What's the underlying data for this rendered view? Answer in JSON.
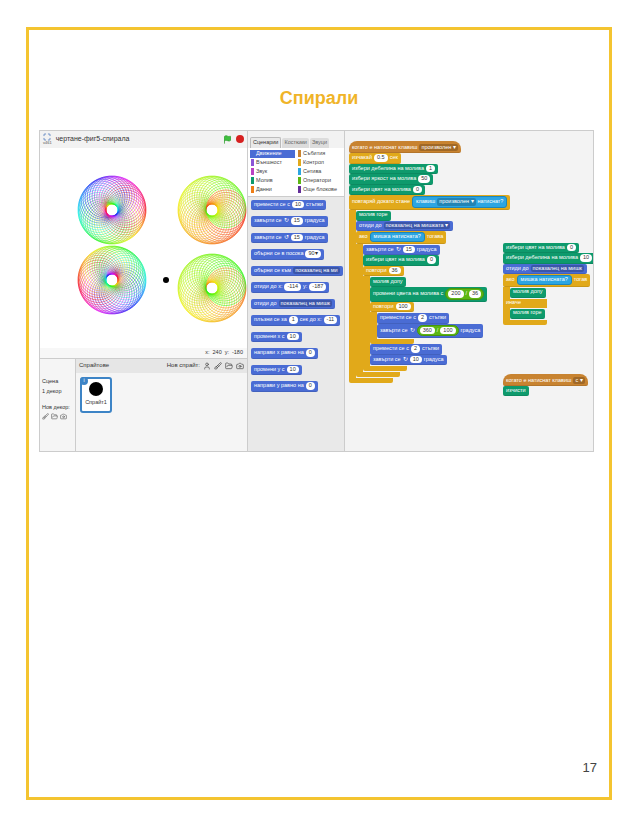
{
  "page": {
    "title": "Спирали",
    "number": "17"
  },
  "stage": {
    "title": "чертане-фиг5-спирала",
    "version": "v461",
    "x_label": "x:",
    "x": "240",
    "y_label": "y:",
    "y": "-180"
  },
  "sprites": {
    "header": "Спрайтове",
    "new_sprite": "Нов спрайт:",
    "stage_label": "Сцена",
    "backdrops": "1 декор",
    "new_backdrop": "Нов декор:",
    "items": [
      {
        "name": "Спрайт1",
        "selected": true,
        "info": "i"
      }
    ]
  },
  "tabs": [
    {
      "label": "Сценарии",
      "selected": true
    },
    {
      "label": "Костюми",
      "selected": false
    },
    {
      "label": "Звуци",
      "selected": false
    }
  ],
  "categories": [
    {
      "label": "Движение",
      "color": "#4a6cd4",
      "selected": true
    },
    {
      "label": "Събития",
      "color": "#c88330",
      "selected": false
    },
    {
      "label": "Външност",
      "color": "#8a55d7",
      "selected": false
    },
    {
      "label": "Контрол",
      "color": "#e1a91a",
      "selected": false
    },
    {
      "label": "Звук",
      "color": "#bb42c3",
      "selected": false
    },
    {
      "label": "Сетива",
      "color": "#2ca5e2",
      "selected": false
    },
    {
      "label": "Молив",
      "color": "#0e9a6c",
      "selected": false
    },
    {
      "label": "Оператори",
      "color": "#5cb712",
      "selected": false
    },
    {
      "label": "Данни",
      "color": "#ee7d16",
      "selected": false
    },
    {
      "label": "Още блокове",
      "color": "#632d99",
      "selected": false
    }
  ],
  "palette": [
    {
      "category": "motion",
      "shape": "stack",
      "parts": [
        {
          "kind": "label",
          "text": "премести се с"
        },
        {
          "kind": "num",
          "text": "10"
        },
        {
          "kind": "label",
          "text": "стъпки"
        }
      ]
    },
    {
      "category": "motion",
      "shape": "stack",
      "parts": [
        {
          "kind": "label",
          "text": "завърти се"
        },
        {
          "kind": "label",
          "text": "↻"
        },
        {
          "kind": "num",
          "text": "15"
        },
        {
          "kind": "label",
          "text": "градуса"
        }
      ]
    },
    {
      "category": "motion",
      "shape": "stack",
      "parts": [
        {
          "kind": "label",
          "text": "завърти се"
        },
        {
          "kind": "label",
          "text": "↺"
        },
        {
          "kind": "num",
          "text": "15"
        },
        {
          "kind": "label",
          "text": "градуса"
        }
      ]
    },
    {
      "category": "motion",
      "shape": "stack",
      "parts": [
        {
          "kind": "label",
          "text": "обърни се в посока"
        },
        {
          "kind": "num",
          "text": "90▾"
        }
      ]
    },
    {
      "category": "motion",
      "shape": "stack",
      "parts": [
        {
          "kind": "label",
          "text": "обърни се към"
        },
        {
          "kind": "drop",
          "text": "показалец на ми"
        }
      ]
    },
    {
      "category": "motion",
      "shape": "stack",
      "parts": [
        {
          "kind": "label",
          "text": "отиди до x:"
        },
        {
          "kind": "num",
          "text": "-114"
        },
        {
          "kind": "label",
          "text": "y:"
        },
        {
          "kind": "num",
          "text": "-187"
        }
      ]
    },
    {
      "category": "motion",
      "shape": "stack",
      "parts": [
        {
          "kind": "label",
          "text": "отиди до"
        },
        {
          "kind": "drop",
          "text": "показалец на мишк"
        }
      ]
    },
    {
      "category": "motion",
      "shape": "stack",
      "parts": [
        {
          "kind": "label",
          "text": "плъзни се за"
        },
        {
          "kind": "num",
          "text": "1"
        },
        {
          "kind": "label",
          "text": "сек до x:"
        },
        {
          "kind": "num",
          "text": "-11"
        }
      ]
    },
    {
      "category": "motion",
      "shape": "stack",
      "parts": [
        {
          "kind": "label",
          "text": "промени x с"
        },
        {
          "kind": "num",
          "text": "10"
        }
      ]
    },
    {
      "category": "motion",
      "shape": "stack",
      "parts": [
        {
          "kind": "label",
          "text": "направи x равно на"
        },
        {
          "kind": "num",
          "text": "0"
        }
      ]
    },
    {
      "category": "motion",
      "shape": "stack",
      "parts": [
        {
          "kind": "label",
          "text": "промени y с"
        },
        {
          "kind": "num",
          "text": "10"
        }
      ]
    },
    {
      "category": "motion",
      "shape": "stack",
      "parts": [
        {
          "kind": "label",
          "text": "направи y равно на"
        },
        {
          "kind": "num",
          "text": "0"
        }
      ]
    }
  ],
  "scripts": [
    {
      "blocks": [
        {
          "category": "events",
          "shape": "hat",
          "parts": [
            {
              "kind": "label",
              "text": "когато е натиснат клавиш"
            },
            {
              "kind": "drop",
              "text": "произволен ▾"
            }
          ]
        },
        {
          "category": "control",
          "shape": "stack",
          "parts": [
            {
              "kind": "label",
              "text": "изчакай"
            },
            {
              "kind": "num",
              "text": "0.5"
            },
            {
              "kind": "label",
              "text": "сек"
            }
          ]
        },
        {
          "category": "pen",
          "shape": "stack",
          "parts": [
            {
              "kind": "label",
              "text": "избери дебелина на молива"
            },
            {
              "kind": "num",
              "text": "1"
            }
          ]
        },
        {
          "category": "pen",
          "shape": "stack",
          "parts": [
            {
              "kind": "label",
              "text": "избери яркост на молива"
            },
            {
              "kind": "num",
              "text": "50"
            }
          ]
        },
        {
          "category": "pen",
          "shape": "stack",
          "parts": [
            {
              "kind": "label",
              "text": "избери цвят на молива"
            },
            {
              "kind": "num",
              "text": "0"
            }
          ]
        },
        {
          "category": "control",
          "shape": "c",
          "parts": [
            {
              "kind": "label",
              "text": "повтаряй докато стане"
            },
            {
              "kind": "bool",
              "parts": [
                {
                  "kind": "label",
                  "text": "клавиш"
                },
                {
                  "kind": "drop",
                  "text": "произволен ▾"
                },
                {
                  "kind": "label",
                  "text": "натиснат?"
                }
              ]
            }
          ],
          "children": [
            {
              "category": "pen",
              "shape": "stack",
              "parts": [
                {
                  "kind": "label",
                  "text": "молив горе"
                }
              ]
            },
            {
              "category": "motion",
              "shape": "stack",
              "parts": [
                {
                  "kind": "label",
                  "text": "отиди до"
                },
                {
                  "kind": "drop",
                  "text": "показалец на мишката ▾"
                }
              ]
            },
            {
              "category": "control",
              "shape": "c",
              "parts": [
                {
                  "kind": "label",
                  "text": "ако"
                },
                {
                  "kind": "bool",
                  "parts": [
                    {
                      "kind": "label",
                      "text": "мишка натисната?"
                    }
                  ]
                },
                {
                  "kind": "label",
                  "text": "тогава"
                }
              ],
              "children": [
                {
                  "category": "motion",
                  "shape": "stack",
                  "parts": [
                    {
                      "kind": "label",
                      "text": "завърти се"
                    },
                    {
                      "kind": "label",
                      "text": "↻"
                    },
                    {
                      "kind": "num",
                      "text": "15"
                    },
                    {
                      "kind": "label",
                      "text": "градуса"
                    }
                  ]
                },
                {
                  "category": "pen",
                  "shape": "stack",
                  "parts": [
                    {
                      "kind": "label",
                      "text": "избери цвят на молива"
                    },
                    {
                      "kind": "num",
                      "text": "0"
                    }
                  ]
                },
                {
                  "category": "control",
                  "shape": "c",
                  "parts": [
                    {
                      "kind": "label",
                      "text": "повтори"
                    },
                    {
                      "kind": "num",
                      "text": "36"
                    }
                  ],
                  "children": [
                    {
                      "category": "pen",
                      "shape": "stack",
                      "parts": [
                        {
                          "kind": "label",
                          "text": "молив долу"
                        }
                      ]
                    },
                    {
                      "category": "pen",
                      "shape": "stack",
                      "parts": [
                        {
                          "kind": "label",
                          "text": "промени цвета на молива с"
                        },
                        {
                          "kind": "op",
                          "parts": [
                            {
                              "kind": "num",
                              "text": "200"
                            },
                            {
                              "kind": "label",
                              "text": "/"
                            },
                            {
                              "kind": "num",
                              "text": "36"
                            }
                          ]
                        }
                      ]
                    },
                    {
                      "category": "control",
                      "shape": "c",
                      "parts": [
                        {
                          "kind": "label",
                          "text": "повтори"
                        },
                        {
                          "kind": "num",
                          "text": "100"
                        }
                      ],
                      "children": [
                        {
                          "category": "motion",
                          "shape": "stack",
                          "parts": [
                            {
                              "kind": "label",
                              "text": "премести се с"
                            },
                            {
                              "kind": "num",
                              "text": "2"
                            },
                            {
                              "kind": "label",
                              "text": "стъпки"
                            }
                          ]
                        },
                        {
                          "category": "motion",
                          "shape": "stack",
                          "parts": [
                            {
                              "kind": "label",
                              "text": "завърти се"
                            },
                            {
                              "kind": "label",
                              "text": "↻"
                            },
                            {
                              "kind": "op",
                              "parts": [
                                {
                                  "kind": "num",
                                  "text": "360"
                                },
                                {
                                  "kind": "label",
                                  "text": "/"
                                },
                                {
                                  "kind": "num",
                                  "text": "100"
                                }
                              ]
                            },
                            {
                              "kind": "label",
                              "text": "градуса"
                            }
                          ]
                        }
                      ]
                    },
                    {
                      "category": "motion",
                      "shape": "stack",
                      "parts": [
                        {
                          "kind": "label",
                          "text": "премести се с"
                        },
                        {
                          "kind": "num",
                          "text": "2"
                        },
                        {
                          "kind": "label",
                          "text": "стъпки"
                        }
                      ]
                    },
                    {
                      "category": "motion",
                      "shape": "stack",
                      "parts": [
                        {
                          "kind": "label",
                          "text": "завърти се"
                        },
                        {
                          "kind": "label",
                          "text": "↻"
                        },
                        {
                          "kind": "num",
                          "text": "10"
                        },
                        {
                          "kind": "label",
                          "text": "градуса"
                        }
                      ]
                    }
                  ]
                }
              ]
            }
          ]
        }
      ]
    },
    {
      "blocks": [
        {
          "category": "pen",
          "shape": "stack",
          "parts": [
            {
              "kind": "label",
              "text": "избери цвят на молива"
            },
            {
              "kind": "num",
              "text": "0"
            }
          ]
        },
        {
          "category": "pen",
          "shape": "stack",
          "parts": [
            {
              "kind": "label",
              "text": "избери дебелина на молива"
            },
            {
              "kind": "num",
              "text": "10"
            }
          ]
        },
        {
          "category": "motion",
          "shape": "stack",
          "parts": [
            {
              "kind": "label",
              "text": "отиди до"
            },
            {
              "kind": "drop",
              "text": "показалец на мишк"
            }
          ]
        },
        {
          "category": "control",
          "shape": "c",
          "parts": [
            {
              "kind": "label",
              "text": "ако"
            },
            {
              "kind": "bool",
              "parts": [
                {
                  "kind": "label",
                  "text": "мишка натисната?"
                }
              ]
            },
            {
              "kind": "label",
              "text": "тогав"
            }
          ],
          "children": [
            {
              "category": "pen",
              "shape": "stack",
              "parts": [
                {
                  "kind": "label",
                  "text": "молив долу"
                }
              ]
            }
          ],
          "else_label": "иначе",
          "else_children": [
            {
              "category": "pen",
              "shape": "stack",
              "parts": [
                {
                  "kind": "label",
                  "text": "молив горе"
                }
              ]
            }
          ]
        }
      ]
    },
    {
      "blocks": [
        {
          "category": "events",
          "shape": "hat",
          "parts": [
            {
              "kind": "label",
              "text": "когато е натиснат клавиш"
            },
            {
              "kind": "drop",
              "text": "с ▾"
            }
          ]
        },
        {
          "category": "pen",
          "shape": "stack",
          "parts": [
            {
              "kind": "label",
              "text": "изчисти"
            }
          ]
        }
      ]
    }
  ]
}
